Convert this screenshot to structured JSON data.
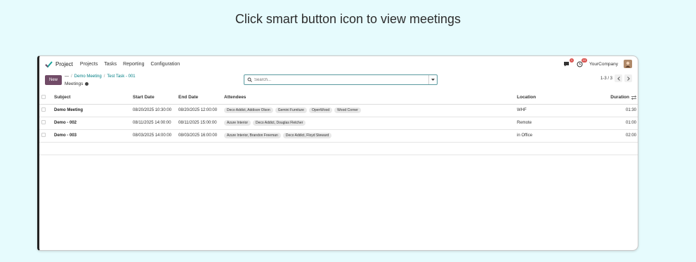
{
  "caption": "Click smart button icon to view meetings",
  "topnav": {
    "app_name": "Project",
    "menus": [
      "Projects",
      "Tasks",
      "Reporting",
      "Configuration"
    ],
    "messages_badge": "1",
    "activity_badge": "10",
    "company": "YourCompany"
  },
  "control": {
    "new_label": "New",
    "breadcrumb": [
      "Demo Meeting",
      "Test Task - 001"
    ],
    "page_title": "Meetings",
    "search_placeholder": "Search...",
    "pager": "1-3 / 3"
  },
  "table": {
    "headers": {
      "subject": "Subject",
      "start": "Start Date",
      "end": "End Date",
      "attendees": "Attendees",
      "location": "Location",
      "duration": "Duration"
    },
    "rows": [
      {
        "subject": "Demo Meeting",
        "start": "08/20/2025 10:30:00",
        "end": "08/20/2025 12:00:00",
        "attendees": [
          "Deco Addict, Addison Olson",
          "Gemini Furniture",
          "OpenWood",
          "Wood Corner"
        ],
        "location": "WHF",
        "duration": "01:30"
      },
      {
        "subject": "Demo - 002",
        "start": "08/11/2025 14:00:00",
        "end": "08/11/2025 15:00:00",
        "attendees": [
          "Azure Interior",
          "Deco Addict, Douglas Fletcher"
        ],
        "location": "Remote",
        "duration": "01:00"
      },
      {
        "subject": "Demo - 003",
        "start": "08/03/2025 14:00:00",
        "end": "08/03/2025 16:00:00",
        "attendees": [
          "Azure Interior, Brandon Freeman",
          "Deco Addict, Floyd Steward"
        ],
        "location": "in Office",
        "duration": "02:00"
      }
    ]
  },
  "colors": {
    "brand": "#714b67",
    "link": "#017e84",
    "background": "#e6fbfd"
  }
}
